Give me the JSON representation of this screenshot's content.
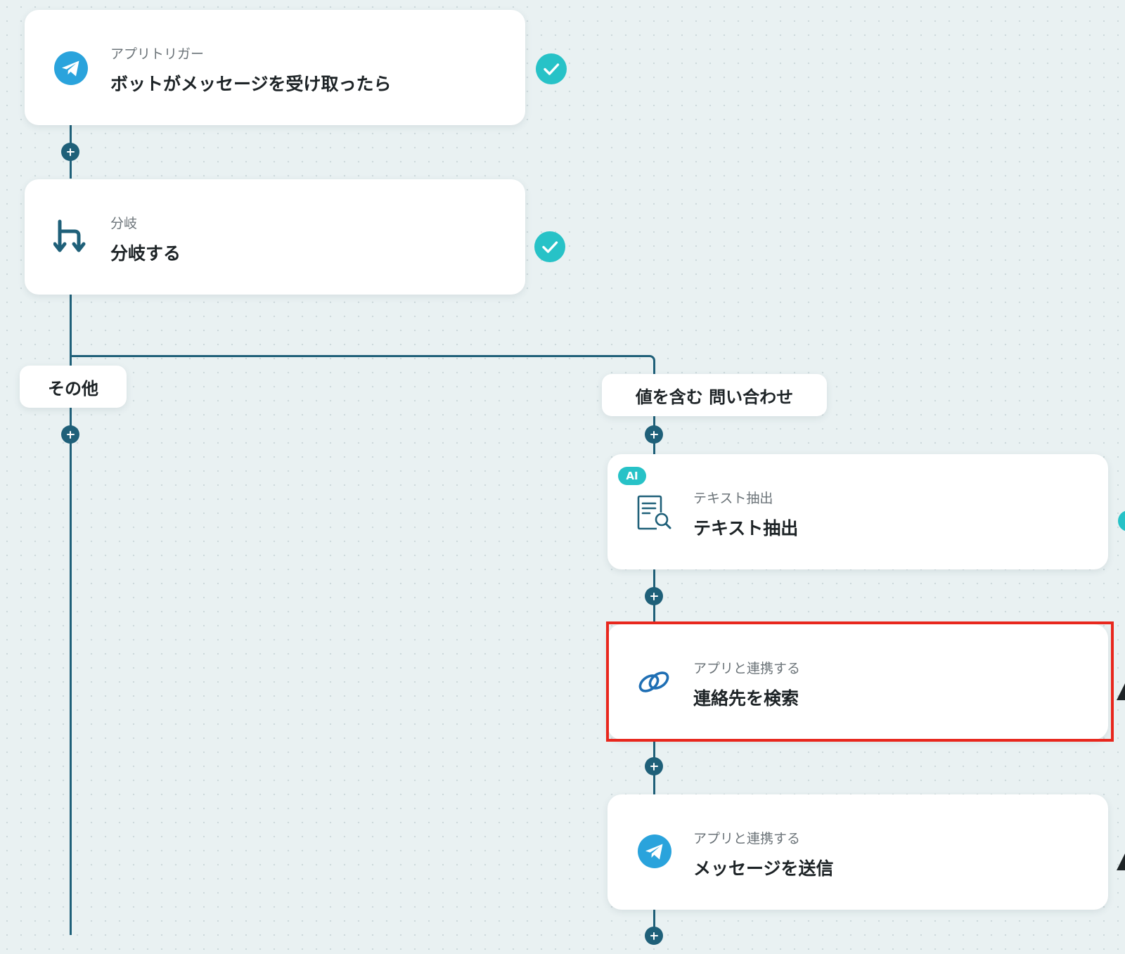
{
  "flow": {
    "trigger": {
      "kind": "アプリトリガー",
      "title": "ボットがメッセージを受け取ったら",
      "icon": "telegram-icon",
      "status": "completed"
    },
    "branch": {
      "kind": "分岐",
      "title": "分岐する",
      "icon": "branch-icon",
      "status": "completed"
    },
    "branch_paths": {
      "other_label": "その他",
      "condition_label": "値を含む 問い合わせ"
    },
    "extract": {
      "badge": "AI",
      "kind": "テキスト抽出",
      "title": "テキスト抽出",
      "icon": "document-search-icon"
    },
    "search_contact": {
      "kind": "アプリと連携する",
      "title": "連絡先を検索",
      "icon": "zoho-link-icon",
      "highlighted": true
    },
    "send_message": {
      "kind": "アプリと連携する",
      "title": "メッセージを送信",
      "icon": "telegram-icon"
    }
  },
  "colors": {
    "background": "#e9f1f2",
    "connector": "#1f6079",
    "check": "#27c2c7",
    "telegram": "#2aa3dc",
    "highlight": "#e8271d"
  }
}
